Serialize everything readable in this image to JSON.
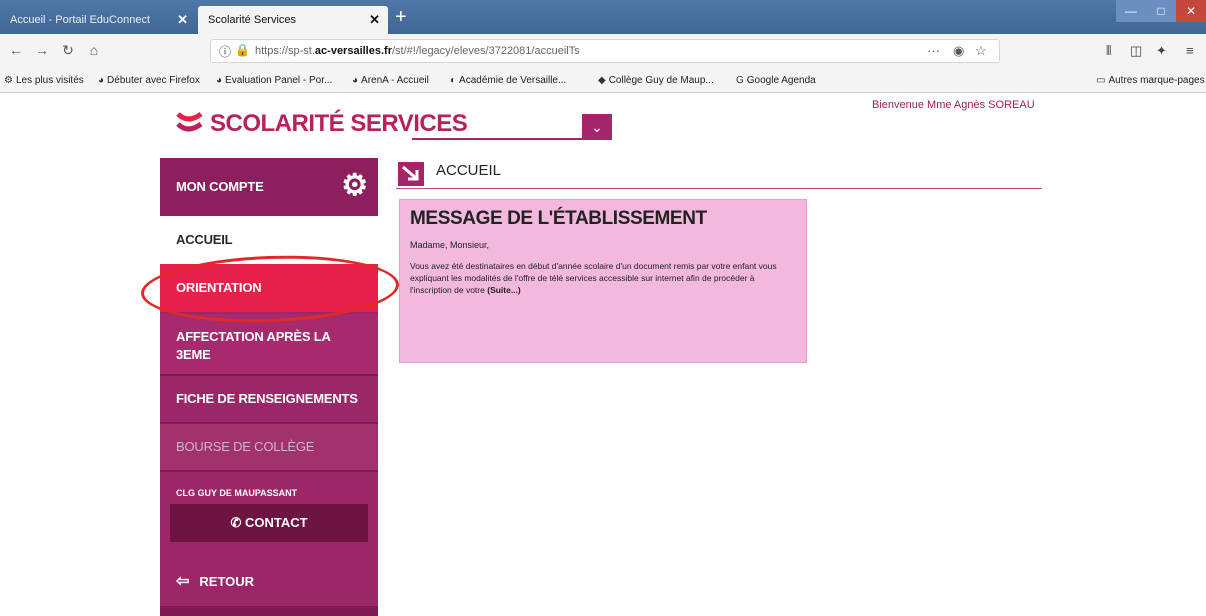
{
  "browser": {
    "tabs": [
      {
        "label": "Accueil - Portail EduConnect",
        "close": "✕"
      },
      {
        "label": "Scolarité Services",
        "close": "✕"
      }
    ],
    "new_tab": "+",
    "url": {
      "prefix": "https://sp-st.",
      "domain": "ac-versailles.fr",
      "path": "/st/#!/legacy/eleves/3722081/accueilTs"
    },
    "url_actions": "···",
    "bookmarks": [
      {
        "label": "Les plus visités",
        "icon": "gear-icon"
      },
      {
        "label": "Débuter avec Firefox",
        "icon": "firefox-icon"
      },
      {
        "label": "Evaluation Panel - Por...",
        "icon": "globe-icon"
      },
      {
        "label": "ArenA - Accueil",
        "icon": "globe-icon"
      },
      {
        "label": "Académie de Versaille...",
        "icon": "globe-icon"
      },
      {
        "label": "Collège Guy de Maup...",
        "icon": "globe-icon"
      },
      {
        "label": "Google Agenda",
        "icon": "google-icon"
      }
    ],
    "other_bookmarks": "Autres marque-pages"
  },
  "header": {
    "logo_text": "Scolarité services",
    "welcome": "Bienvenue Mme Agnès SOREAU"
  },
  "sidebar": {
    "account": "Mon compte",
    "items": [
      {
        "label": "Accueil"
      },
      {
        "label": "Orientation"
      },
      {
        "label": "Affectation après la 3eme"
      },
      {
        "label": "Fiche de renseignements"
      },
      {
        "label": "Bourse de collège"
      }
    ],
    "college": "CLG GUY DE MAUPASSANT",
    "contact": "CONTACT",
    "back": "RETOUR"
  },
  "content": {
    "section_title": "Accueil",
    "message": {
      "title": "Message de l'établissement",
      "greeting": "Madame, Monsieur,",
      "body": "Vous avez été destinataires en début d'année scolaire d'un document remis par votre enfant vous expliquant les modalités de l'offre de télé services accessible sur internet afin de procéder à l'inscription de votre",
      "more": "(Suite...)"
    }
  },
  "colors": {
    "brand": "#a5256a",
    "active": "#e8214a",
    "message_bg": "#f2b8dd",
    "annotation": "#e02a2a"
  }
}
